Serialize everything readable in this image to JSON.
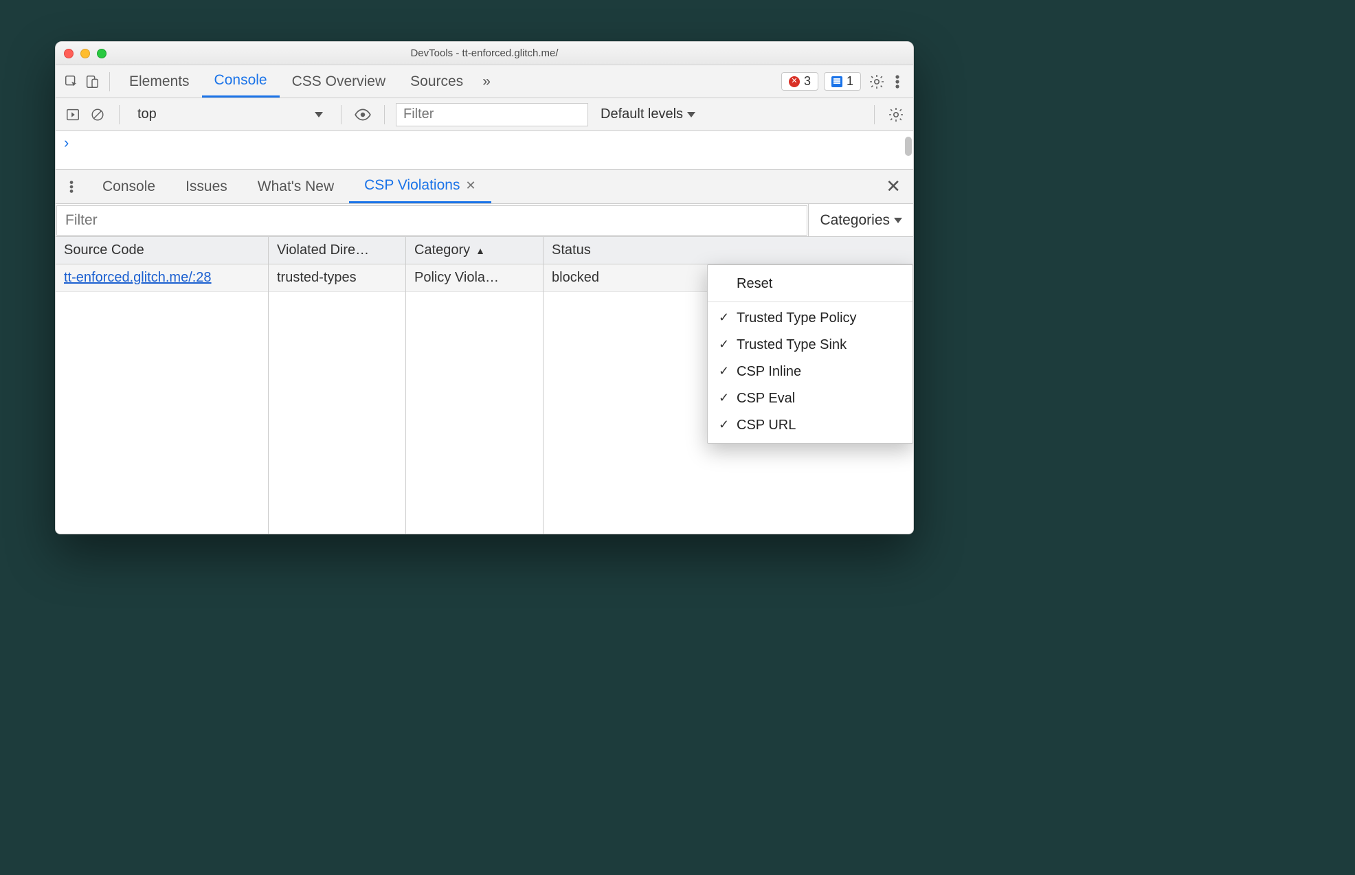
{
  "window": {
    "title": "DevTools - tt-enforced.glitch.me/"
  },
  "topTabs": {
    "items": [
      "Elements",
      "Console",
      "CSS Overview",
      "Sources"
    ],
    "activeIndex": 1,
    "more": "»"
  },
  "counters": {
    "errors": "3",
    "messages": "1"
  },
  "consoleToolbar": {
    "context": "top",
    "filterPlaceholder": "Filter",
    "levels": "Default levels"
  },
  "drawerTabs": {
    "items": [
      "Console",
      "Issues",
      "What's New",
      "CSP Violations"
    ],
    "activeIndex": 3
  },
  "violations": {
    "filterPlaceholder": "Filter",
    "categoriesLabel": "Categories",
    "headers": {
      "source": "Source Code",
      "directive": "Violated Dire…",
      "category": "Category",
      "status": "Status"
    },
    "rows": [
      {
        "source": "tt-enforced.glitch.me/:28",
        "directive": "trusted-types",
        "category": "Policy Viola…",
        "status": "blocked"
      }
    ]
  },
  "categoriesMenu": {
    "reset": "Reset",
    "options": [
      {
        "label": "Trusted Type Policy",
        "checked": true
      },
      {
        "label": "Trusted Type Sink",
        "checked": true
      },
      {
        "label": "CSP Inline",
        "checked": true
      },
      {
        "label": "CSP Eval",
        "checked": true
      },
      {
        "label": "CSP URL",
        "checked": true
      }
    ]
  }
}
